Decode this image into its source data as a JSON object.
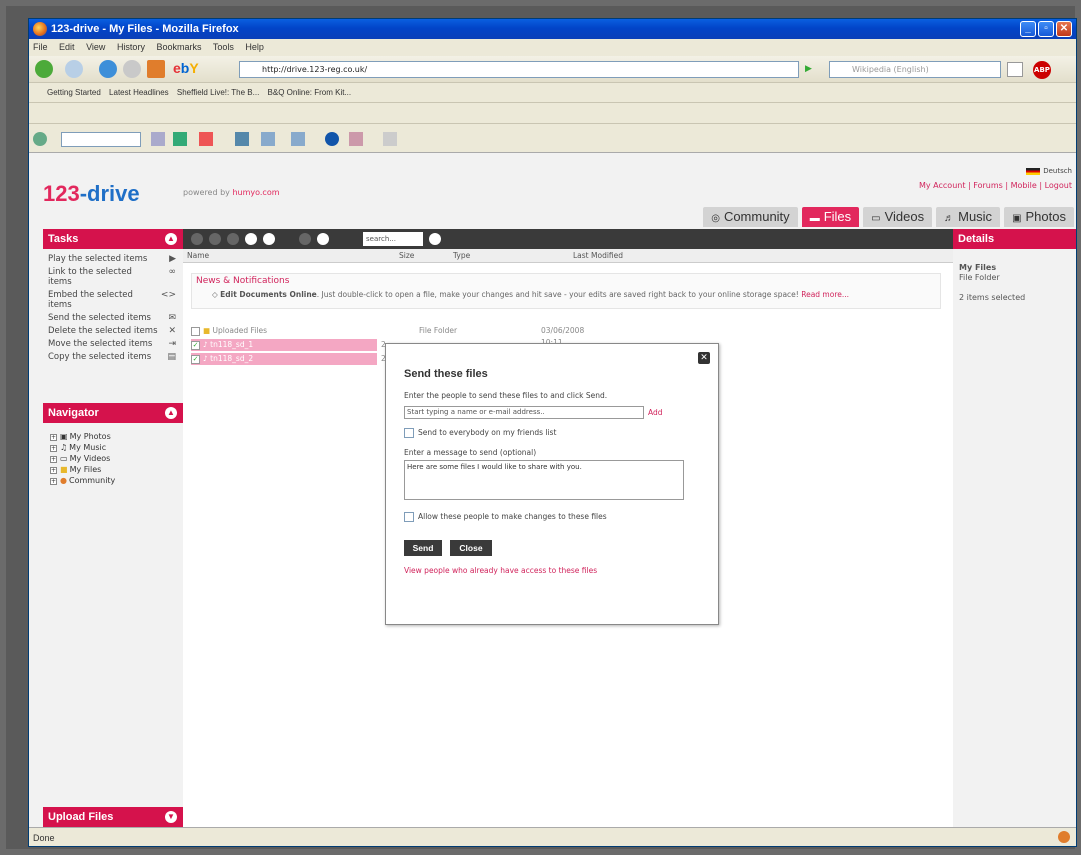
{
  "window": {
    "title": "123-drive - My Files - Mozilla Firefox"
  },
  "menu": [
    "File",
    "Edit",
    "View",
    "History",
    "Bookmarks",
    "Tools",
    "Help"
  ],
  "nav": {
    "url": "http://drive.123-reg.co.uk/",
    "search_placeholder": "Wikipedia (English)"
  },
  "bookmarks": [
    "Getting Started",
    "Latest Headlines",
    "Sheffield Live!: The B...",
    "B&Q Online: From Kit..."
  ],
  "site": {
    "logo_num": "123",
    "logo_text": "-drive",
    "powered_label": "powered by",
    "powered_brand": "humyo.com",
    "language": "Deutsch",
    "account_links": "My Account | Forums | Mobile | Logout",
    "tabs": [
      "Community",
      "Files",
      "Videos",
      "Music",
      "Photos"
    ],
    "active_tab": "Files"
  },
  "tasks": {
    "title": "Tasks",
    "items": [
      "Play the selected items",
      "Link to the selected items",
      "Embed the selected items",
      "Send the selected items",
      "Delete the selected items",
      "Move the selected items",
      "Copy the selected items"
    ]
  },
  "navigator": {
    "title": "Navigator",
    "items": [
      "My Photos",
      "My Music",
      "My Videos",
      "My Files",
      "Community"
    ]
  },
  "upload": {
    "title": "Upload Files"
  },
  "toolbar": {
    "search_placeholder": "search..."
  },
  "columns": [
    "Name",
    "Size",
    "Type",
    "Last Modified"
  ],
  "news": {
    "title": "News & Notifications",
    "headline": "Edit Documents Online",
    "body": ". Just double-click to open a file, make your changes and hit save - your edits are saved right back to your online storage space!",
    "link": "Read more..."
  },
  "files": [
    {
      "name": "Uploaded Files",
      "size": "",
      "type": "File Folder",
      "modified": "03/06/2008 10:11",
      "selected": false
    },
    {
      "name": "tn118_sd_1",
      "size": "2",
      "type": "",
      "modified": "",
      "selected": true
    },
    {
      "name": "tn118_sd_2",
      "size": "2",
      "type": "",
      "modified": "",
      "selected": true
    }
  ],
  "details": {
    "title": "Details",
    "name": "My Files",
    "type": "File Folder",
    "selection": "2 items selected"
  },
  "dialog": {
    "title": "Send these files",
    "to_label": "Enter the people to send these files to and click Send.",
    "to_placeholder": "Start typing a name or e-mail address..",
    "add_label": "Add",
    "everybody_label": "Send to everybody on my friends list",
    "message_label": "Enter a message to send (optional)",
    "message_value": "Here are some files I would like to share with you.",
    "allow_label": "Allow these people to make changes to these files",
    "send_label": "Send",
    "close_label": "Close",
    "view_link": "View people who already have access to these files"
  },
  "status": {
    "text": "Done"
  }
}
